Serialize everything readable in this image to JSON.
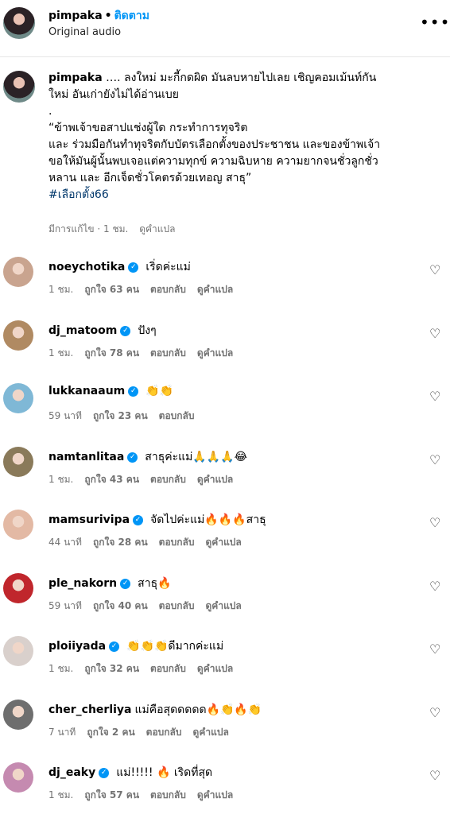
{
  "header": {
    "username": "pimpaka",
    "separator": "•",
    "follow_label": "ติดตาม",
    "audio_label": "Original audio",
    "more_icon": "more-horizontal-icon"
  },
  "caption": {
    "username": "pimpaka",
    "lines": [
      "…. ลงใหม่ มะกี้กดผิด มันลบหายไปเลย เชิญคอมเม้นท์กัน",
      "ใหม่ อันเก่ายังไม่ได้อ่านเบย",
      ".",
      "“ข้าพเจ้าขอสาปแช่งผู้ใด กระทำการทุจริต",
      "และ ร่วมมือกันทำทุจริตกับบัตรเลือกตั้งของประชาชน และของข้าพเจ้า",
      "ขอให้มันผู้นั้นพบเจอแต่ความทุกข์ ความฉิบหาย ความยากจนชั่วลูกชั่ว",
      "หลาน และ อีกเจ็ดชั่วโคตรด้วยเทอญ สาธุ”"
    ],
    "hashtag": "#เลือกตั้ง66",
    "meta_edited": "มีการแก้ไข · 1 ชม.",
    "meta_translate": "ดูคำแปล"
  },
  "comments": [
    {
      "username": "noeychotika",
      "verified": true,
      "text": "เริ่ดค่ะแม่",
      "time": "1 ชม.",
      "likes": "ถูกใจ 63 คน",
      "reply": "ตอบกลับ",
      "translate": "ดูคำแปล",
      "avatar_color": "#c9a48f"
    },
    {
      "username": "dj_matoom",
      "verified": true,
      "text": "ปังๆ",
      "time": "1 ชม.",
      "likes": "ถูกใจ 78 คน",
      "reply": "ตอบกลับ",
      "translate": "ดูคำแปล",
      "avatar_color": "#b08a62"
    },
    {
      "username": "lukkanaaum",
      "verified": true,
      "text": "👏👏",
      "time": "59 นาที",
      "likes": "ถูกใจ 23 คน",
      "reply": "ตอบกลับ",
      "translate": "",
      "avatar_color": "#7fb8d6"
    },
    {
      "username": "namtanlitaa",
      "verified": true,
      "text": "สาธุค่ะแม่🙏🙏🙏😂",
      "time": "1 ชม.",
      "likes": "ถูกใจ 43 คน",
      "reply": "ตอบกลับ",
      "translate": "ดูคำแปล",
      "avatar_color": "#8a7a5a"
    },
    {
      "username": "mamsurivipa",
      "verified": true,
      "text": "จัดไปค่ะแม่🔥🔥🔥สาธุ",
      "time": "44 นาที",
      "likes": "ถูกใจ 28 คน",
      "reply": "ตอบกลับ",
      "translate": "ดูคำแปล",
      "avatar_color": "#e3b9a4"
    },
    {
      "username": "ple_nakorn",
      "verified": true,
      "text": "สาธุ🔥",
      "time": "59 นาที",
      "likes": "ถูกใจ 40 คน",
      "reply": "ตอบกลับ",
      "translate": "ดูคำแปล",
      "avatar_color": "#c0262c"
    },
    {
      "username": "ploiiyada",
      "verified": true,
      "text": "👏👏👏ดีมากค่ะแม่",
      "time": "1 ชม.",
      "likes": "ถูกใจ 32 คน",
      "reply": "ตอบกลับ",
      "translate": "ดูคำแปล",
      "avatar_color": "#d9d0cc"
    },
    {
      "username": "cher_cherliya",
      "verified": false,
      "text": "แม่คือสุดดดดด🔥👏🔥👏",
      "time": "7 นาที",
      "likes": "ถูกใจ 2 คน",
      "reply": "ตอบกลับ",
      "translate": "ดูคำแปล",
      "avatar_color": "#6e6e6e"
    },
    {
      "username": "dj_eaky",
      "verified": true,
      "text": "แม่!!!!! 🔥 เริดที่สุด",
      "time": "1 ชม.",
      "likes": "ถูกใจ 57 คน",
      "reply": "ตอบกลับ",
      "translate": "ดูคำแปล",
      "avatar_color": "#c58ab0"
    }
  ],
  "icons": {
    "heart": "heart-outline-icon",
    "verified": "verified-badge-icon"
  },
  "colors": {
    "link_blue": "#0095f6",
    "hashtag": "#00376b",
    "meta_gray": "#737373",
    "divider": "#e6e6e6"
  }
}
